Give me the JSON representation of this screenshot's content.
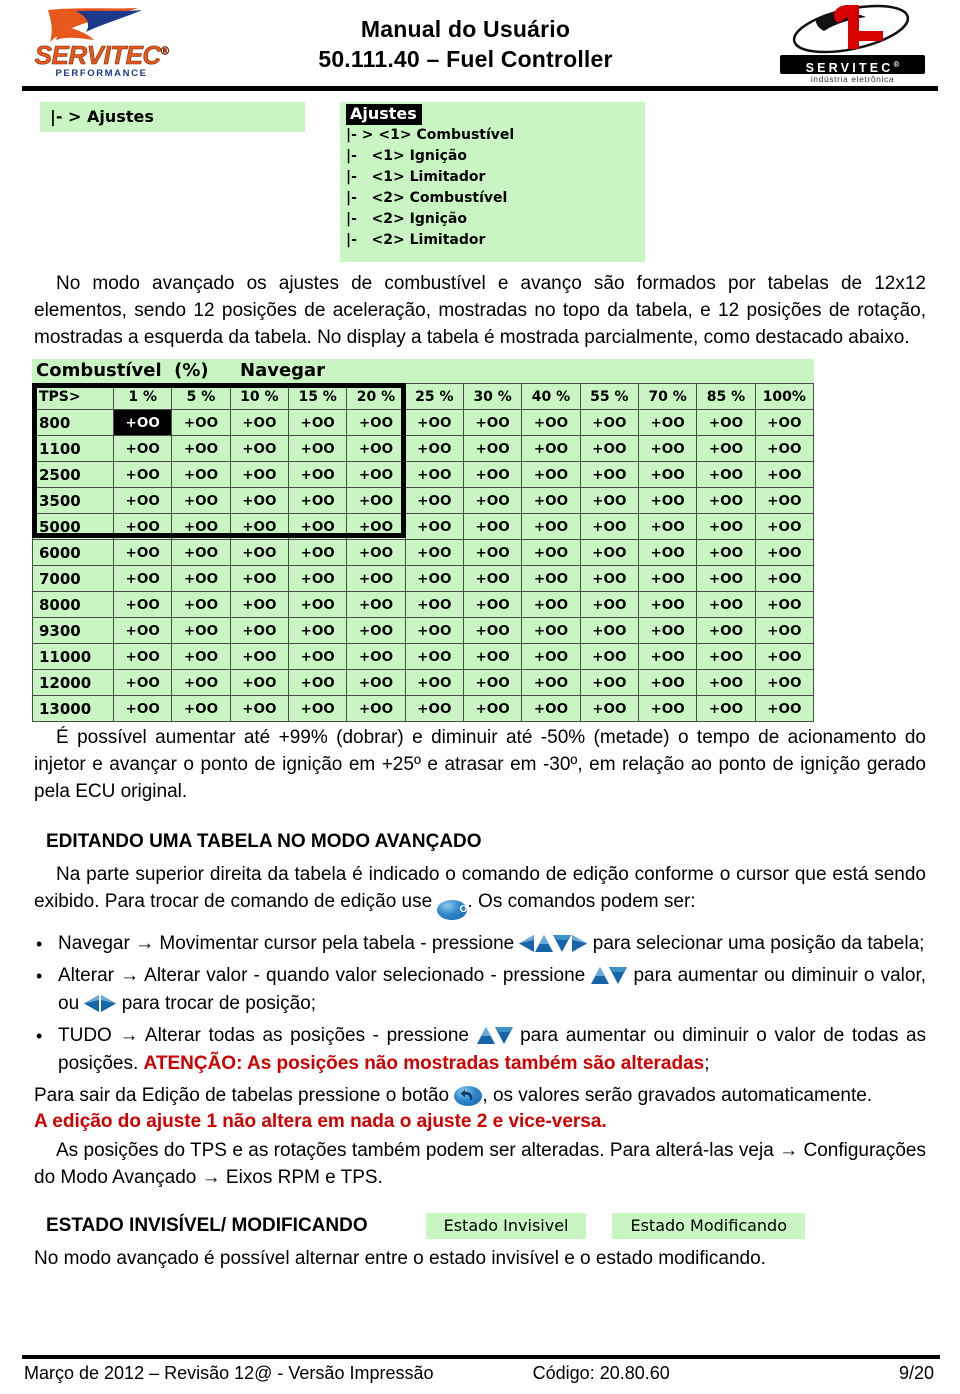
{
  "header": {
    "title_line1": "Manual do Usuário",
    "title_line2": "50.111.40 – Fuel Controller",
    "logo_left_word": "SERVITEC",
    "logo_left_reg": "®",
    "logo_left_sub": "PERFORMANCE",
    "logo_right_word": "SERVITEC",
    "logo_right_reg": "®",
    "logo_right_sub": "indústria eletrônica"
  },
  "menu_display": {
    "left_line": "|- > Ajustes",
    "title": "Ajustes",
    "items": [
      "|- > <1> Combustível",
      "|-   <1> Ignição",
      "|-   <1> Limitador",
      "|-   <2> Combustível",
      "|-   <2> Ignição",
      "|-   <2> Limitador"
    ]
  },
  "intro_paragraph": "No modo avançado os ajustes de combustível e avanço são formados por tabelas de 12x12 elementos, sendo 12 posições de aceleração, mostradas no topo da tabela, e 12 posições de rotação, mostradas a esquerda da tabela. No display a tabela é mostrada parcialmente, como destacado abaixo.",
  "table": {
    "caption_title": "Combustível  (%)",
    "caption_mode": "Navegar",
    "corner_label": "TPS>",
    "tps_columns": [
      "1 %",
      "5 %",
      "10 %",
      "15 %",
      "20 %",
      "25 %",
      "30 %",
      "40 %",
      "55 %",
      "70 %",
      "85 %",
      "100%"
    ],
    "rpm_rows": [
      "800",
      "1100",
      "2500",
      "3500",
      "5000",
      "6000",
      "7000",
      "8000",
      "9300",
      "11000",
      "12000",
      "13000"
    ],
    "cell_value": "+OO",
    "selected_cell": {
      "row": 0,
      "col": 0
    },
    "highlight_block": {
      "rows": 5,
      "cols": 5
    }
  },
  "range_paragraph": "É possível aumentar até +99% (dobrar) e diminuir até -50% (metade) o tempo de acionamento do injetor e avançar o ponto de ignição em +25º e atrasar em -30º, em relação ao ponto de ignição gerado pela ECU original.",
  "editing": {
    "heading": "EDITANDO UMA TABELA NO MODO AVANÇADO",
    "intro_a": "Na parte superior direita da tabela é indicado o comando de edição conforme o cursor que está sendo exibido. Para trocar de comando de edição use ",
    "ok_icon_label": "OK",
    "intro_b": ". Os comandos podem ser:",
    "commands": [
      {
        "part_a": "Navegar → Movimentar cursor pela tabela - pressione ",
        "icons": "left-up-down-right-arrows",
        "part_b": " para selecionar uma posição da tabela;"
      },
      {
        "part_a": "Alterar → Alterar valor - quando valor selecionado - pressione ",
        "icons": "up-down-arrows",
        "part_b": " para aumentar ou diminuir o valor, ou ",
        "icons2": "left-right-arrows",
        "part_c": " para trocar de posição;"
      },
      {
        "part_a": "TUDO → Alterar todas as posições - pressione ",
        "icons": "up-down-arrows",
        "part_b": " para aumentar ou diminuir o valor de todas as posições. ",
        "warning": "ATENÇÃO: As posições não mostradas também são alteradas",
        "part_c": ";"
      }
    ],
    "exit_a": "Para sair da Edição de tabelas pressione o botão ",
    "exit_b": ", os valores serão gravados automaticamente.",
    "red_note": "A edição do ajuste 1 não altera em nada o ajuste 2 e vice-versa.",
    "axes_note": "As posições do TPS e as rotações também podem ser alteradas. Para alterá-las veja → Configurações do Modo Avançado → Eixos RPM e TPS."
  },
  "states": {
    "heading": "ESTADO INVISÍVEL/ MODIFICANDO",
    "badge_invisible": "Estado Invisivel",
    "badge_modifying": "Estado Modificando",
    "description": "No modo avançado é possível alternar entre o estado invisível e o estado modificando."
  },
  "footer": {
    "left": "Março de 2012 – Revisão 12@ - Versão Impressão",
    "middle": "Código: 20.80.60",
    "right": "9/20"
  },
  "colors": {
    "lcd_green": "#C9F5C2",
    "accent_blue": "#2d86c9",
    "warning_red": "#D00000",
    "brand_orange": "#E8581C"
  }
}
